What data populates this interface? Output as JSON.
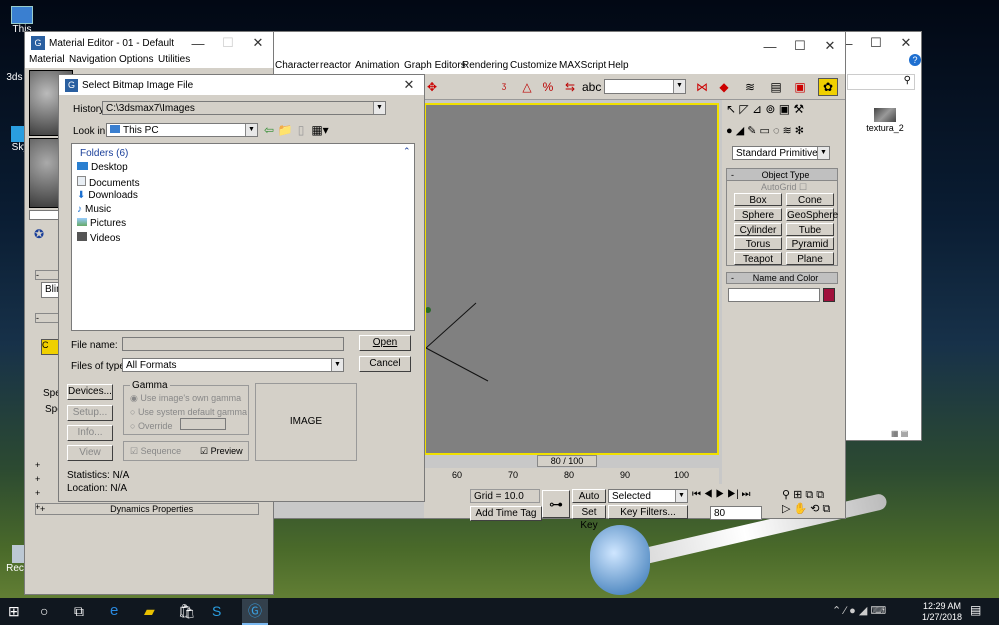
{
  "desktop": {
    "icons": [
      "This",
      "3ds m",
      "Sky",
      "Recyc"
    ],
    "right_file_label": "textura_2"
  },
  "explorer_window": {
    "search_icon": "search-icon",
    "help_icon": "help-icon"
  },
  "max_window": {
    "menu": [
      "Character",
      "reactor",
      "Animation",
      "Graph Editors",
      "Rendering",
      "Customize",
      "MAXScript",
      "Help"
    ],
    "timeline": {
      "position": "80 / 100",
      "ticks": [
        "60",
        "70",
        "80",
        "90",
        "100"
      ]
    },
    "grid_label": "Grid = 10.0",
    "add_time_tag": "Add Time Tag",
    "auto_key": "Auto Key",
    "set_key": "Set Key",
    "selected": "Selected",
    "key_filters": "Key Filters...",
    "frame": "80",
    "create_panel": {
      "primitive_type": "Standard Primitives",
      "object_type_header": "Object Type",
      "autogrid": "AutoGrid",
      "buttons": [
        "Box",
        "Cone",
        "Sphere",
        "GeoSphere",
        "Cylinder",
        "Tube",
        "Torus",
        "Pyramid",
        "Teapot",
        "Plane"
      ],
      "name_color_header": "Name and Color",
      "color": "#a0113c"
    }
  },
  "material_editor": {
    "title": "Material Editor - 01 - Default",
    "menu": [
      "Material",
      "Navigation",
      "Options",
      "Utilities"
    ],
    "shader_text": "Blin",
    "spec_text": "Spe",
    "spe_text": "Spe",
    "dynamics": "Dynamics Properties"
  },
  "dialog": {
    "title": "Select Bitmap Image File",
    "history_label": "History:",
    "history_value": "C:\\3dsmax7\\Images",
    "lookin_label": "Look in:",
    "lookin_value": "This PC",
    "folders_header": "Folders (6)",
    "folders": [
      "Desktop",
      "Documents",
      "Downloads",
      "Music",
      "Pictures",
      "Videos"
    ],
    "filename_label": "File name:",
    "filename_value": "",
    "filetype_label": "Files of type:",
    "filetype_value": "All Formats",
    "open": "Open",
    "cancel": "Cancel",
    "gamma": {
      "header": "Gamma",
      "opt1": "Use image's own gamma",
      "opt2": "Use system default gamma",
      "opt3": "Override"
    },
    "devices": "Devices...",
    "setup": "Setup...",
    "info": "Info...",
    "view": "View",
    "sequence": "Sequence",
    "preview": "Preview",
    "image_placeholder": "IMAGE",
    "statistics": "Statistics:  N/A",
    "location": "Location:  N/A"
  },
  "taskbar": {
    "time": "12:29 AM",
    "date": "1/27/2018"
  }
}
